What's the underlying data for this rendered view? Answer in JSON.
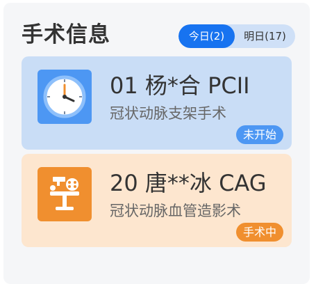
{
  "header": {
    "title": "手术信息"
  },
  "tabs": [
    {
      "label": "今日(2)",
      "active": true
    },
    {
      "label": "明日(17)",
      "active": false
    }
  ],
  "cards": [
    {
      "line1": "01 杨*合 PCII",
      "line2": "冠状动脉支架手术",
      "status": "未开始",
      "icon": "clock-icon",
      "color": "#4d97f3"
    },
    {
      "line1": "20 唐**冰 CAG",
      "line2": "冠状动脉血管造影术",
      "status": "手术中",
      "icon": "surgery-icon",
      "color": "#f08f2f"
    }
  ]
}
